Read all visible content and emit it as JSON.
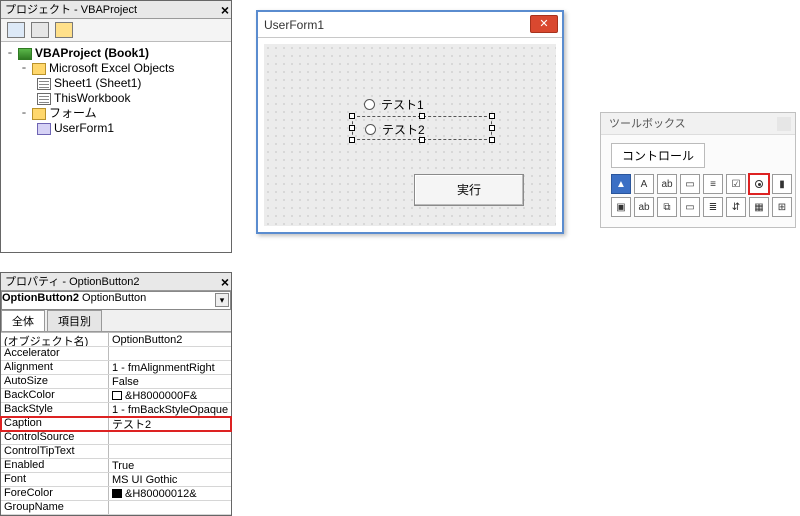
{
  "project": {
    "title": "プロジェクト - VBAProject",
    "tree": {
      "root": "VBAProject (Book1)",
      "excel_objects": "Microsoft Excel Objects",
      "sheet1": "Sheet1 (Sheet1)",
      "thisworkbook": "ThisWorkbook",
      "forms_folder": "フォーム",
      "userform1": "UserForm1"
    }
  },
  "properties": {
    "title": "プロパティ - OptionButton2",
    "object_name": "OptionButton2",
    "object_type": "OptionButton",
    "tab_all": "全体",
    "tab_cat": "項目別",
    "rows": [
      {
        "k": "(オブジェクト名)",
        "v": "OptionButton2"
      },
      {
        "k": "Accelerator",
        "v": ""
      },
      {
        "k": "Alignment",
        "v": "1 - fmAlignmentRight"
      },
      {
        "k": "AutoSize",
        "v": "False"
      },
      {
        "k": "BackColor",
        "v": "&H8000000F&",
        "swatch": "white"
      },
      {
        "k": "BackStyle",
        "v": "1 - fmBackStyleOpaque"
      },
      {
        "k": "Caption",
        "v": "テスト2",
        "hl": true
      },
      {
        "k": "ControlSource",
        "v": ""
      },
      {
        "k": "ControlTipText",
        "v": ""
      },
      {
        "k": "Enabled",
        "v": "True"
      },
      {
        "k": "Font",
        "v": "MS UI Gothic"
      },
      {
        "k": "ForeColor",
        "v": "&H80000012&",
        "swatch": "black"
      },
      {
        "k": "GroupName",
        "v": ""
      }
    ]
  },
  "form": {
    "title": "UserForm1",
    "option1": "テスト1",
    "option2": "テスト2",
    "exec": "実行"
  },
  "toolbox": {
    "title": "ツールボックス",
    "tab": "コントロール",
    "tools_row1": [
      "pointer",
      "label",
      "textbox",
      "combobox",
      "listbox",
      "checkbox",
      "optionbutton",
      "toggle"
    ],
    "tools_row2": [
      "frame",
      "commandbutton",
      "tabstrip",
      "multipage",
      "scrollbar",
      "spin",
      "image",
      "refedit"
    ],
    "glyphs": {
      "pointer": "▲",
      "label": "A",
      "textbox": "ab",
      "combobox": "▭",
      "listbox": "≡",
      "checkbox": "☑",
      "optionbutton": "",
      "toggle": "▮",
      "frame": "▣",
      "commandbutton": "ab",
      "tabstrip": "⧉",
      "multipage": "▭",
      "scrollbar": "≣",
      "spin": "⇵",
      "image": "▦",
      "refedit": "⊞"
    }
  }
}
